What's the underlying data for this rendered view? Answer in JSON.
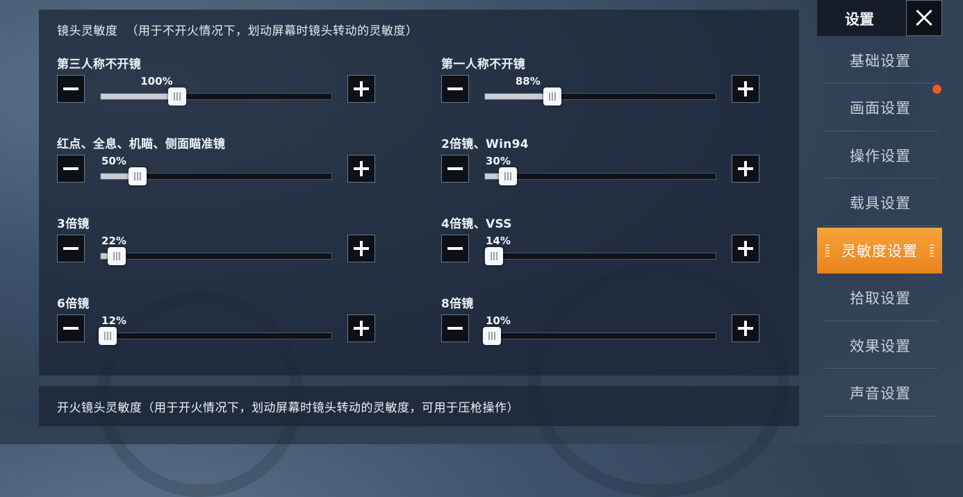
{
  "sidebar": {
    "title": "设置",
    "close_icon": "close-icon",
    "items": [
      {
        "label": "基础设置",
        "active": false
      },
      {
        "label": "画面设置",
        "active": false,
        "notification": true
      },
      {
        "label": "操作设置",
        "active": false
      },
      {
        "label": "载具设置",
        "active": false
      },
      {
        "label": "灵敏度设置",
        "active": true
      },
      {
        "label": "拾取设置",
        "active": false
      },
      {
        "label": "效果设置",
        "active": false
      },
      {
        "label": "声音设置",
        "active": false
      }
    ],
    "accent_color": "#f08c24",
    "notification_color": "#f05a1e"
  },
  "camera_sensitivity": {
    "title": "镜头灵敏度",
    "hint": "（用于不开火情况下，划动屏幕时镜头转动的灵敏度）",
    "settings": [
      {
        "label": "第三人称不开镜",
        "value_text": "100%",
        "level": 0.33
      },
      {
        "label": "第一人称不开镜",
        "value_text": "88%",
        "level": 0.29
      },
      {
        "label": "红点、全息、机瞄、侧面瞄准镜",
        "value_text": "50%",
        "level": 0.16
      },
      {
        "label": "2倍镜、Win94",
        "value_text": "30%",
        "level": 0.1
      },
      {
        "label": "3倍镜",
        "value_text": "22%",
        "level": 0.07
      },
      {
        "label": "4倍镜、VSS",
        "value_text": "14%",
        "level": 0.04
      },
      {
        "label": "6倍镜",
        "value_text": "12%",
        "level": 0.03
      },
      {
        "label": "8倍镜",
        "value_text": "10%",
        "level": 0.03
      }
    ],
    "minus_icon": "minus-icon",
    "plus_icon": "plus-icon"
  },
  "fire_sensitivity": {
    "title": "开火镜头灵敏度（用于开火情况下，划动屏幕时镜头转动的灵敏度，可用于压枪操作）"
  }
}
